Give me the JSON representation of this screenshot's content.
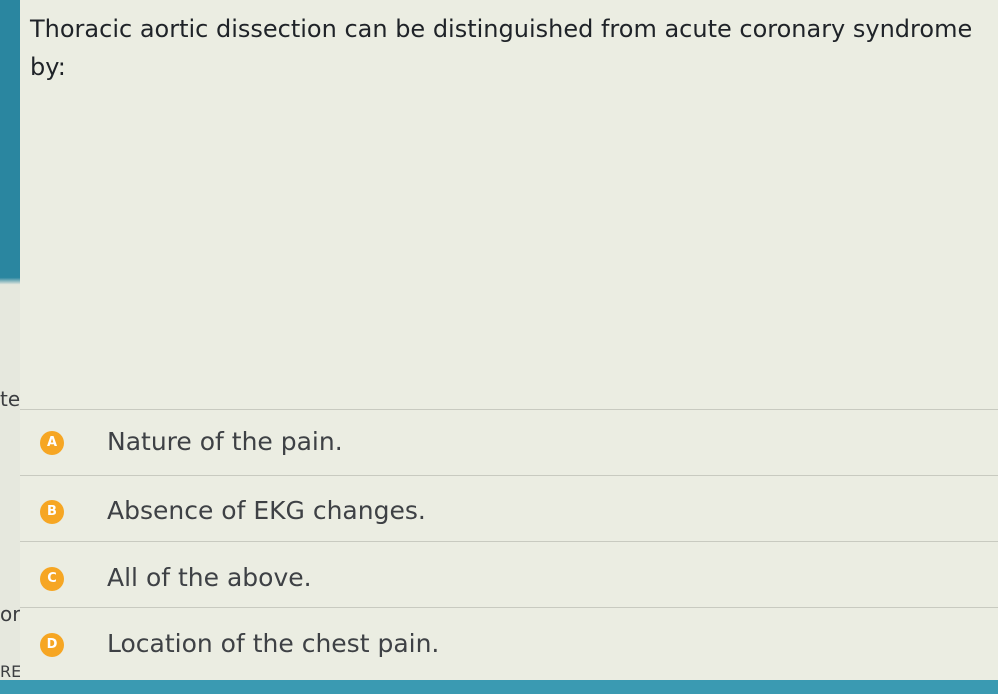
{
  "question": {
    "text": "Thoracic aortic dissection can be distinguished from acute coronary syndrome by:"
  },
  "options": [
    {
      "letter": "A",
      "text": "Nature of the pain."
    },
    {
      "letter": "B",
      "text": "Absence of EKG changes."
    },
    {
      "letter": "C",
      "text": "All of the above."
    },
    {
      "letter": "D",
      "text": "Location of the chest pain."
    }
  ],
  "background_fragments": [
    "te",
    "or",
    "RE"
  ],
  "colors": {
    "badge": "#f6a623",
    "accent_teal": "#2a86a0",
    "panel": "#ebede2",
    "text": "#1f2328"
  }
}
